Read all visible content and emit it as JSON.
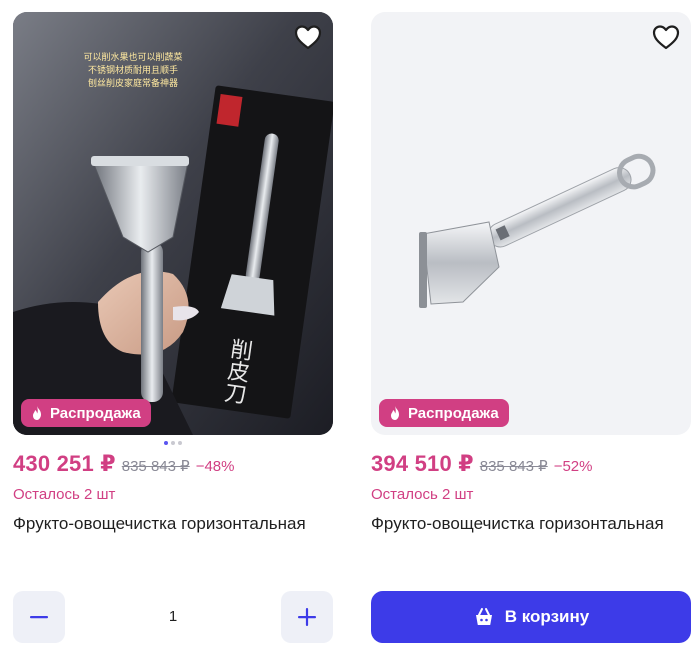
{
  "products": [
    {
      "image_text_chinese": "削皮刀",
      "image_text_caption": "可以削水果也可以削蔬菜\n不锈钢材质耐用且顺手\n刨丝削皮家庭常备神器",
      "sale_label": "Распродажа",
      "price": "430 251 ₽",
      "old_price": "835 843 ₽",
      "discount": "−48%",
      "stock": "Осталось 2 шт",
      "title": "Фрукто-овощечистка горизонтальная",
      "quantity": "1",
      "carousel_dots": 3,
      "carousel_active": 0
    },
    {
      "sale_label": "Распродажа",
      "price": "394 510 ₽",
      "old_price": "835 843 ₽",
      "discount": "−52%",
      "stock": "Осталось 2 шт",
      "title": "Фрукто-овощечистка горизонтальная",
      "cart_label": "В корзину"
    }
  ],
  "colors": {
    "accent_pink": "#d13f83",
    "cart_blue": "#3d3be8",
    "muted_gray": "#8a8a96"
  },
  "icons": [
    "heart-icon",
    "fire-icon",
    "minus-icon",
    "plus-icon",
    "basket-icon"
  ]
}
